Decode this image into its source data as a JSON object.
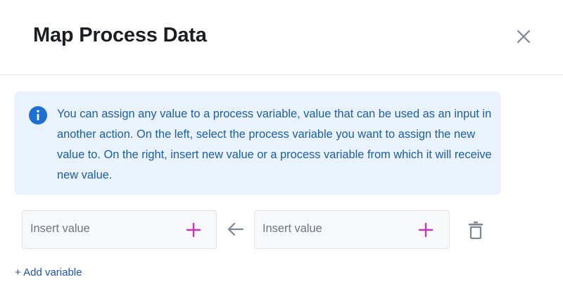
{
  "dialog": {
    "title": "Map Process Data",
    "close_icon": "close-icon"
  },
  "info": {
    "icon": "info-icon",
    "text": "You can assign any value to a process variable, value that can be used as an input in another action. On the left, select the process variable you want to assign the new value to. On the right, insert new value or a process variable from which it will receive new value."
  },
  "mapping_row": {
    "left_placeholder": "Insert value",
    "right_placeholder": "Insert value",
    "plus_icon": "plus-icon",
    "arrow_icon": "arrow-left-icon",
    "delete_icon": "trash-icon"
  },
  "add_variable_label": "+ Add variable",
  "colors": {
    "title": "#1b1f24",
    "info_bg": "#e9f2fd",
    "info_text": "#1b5fa6",
    "info_icon": "#1d6fd1",
    "plus": "#c535b8",
    "link": "#1f4fb8",
    "icon_gray": "#7d8793"
  }
}
